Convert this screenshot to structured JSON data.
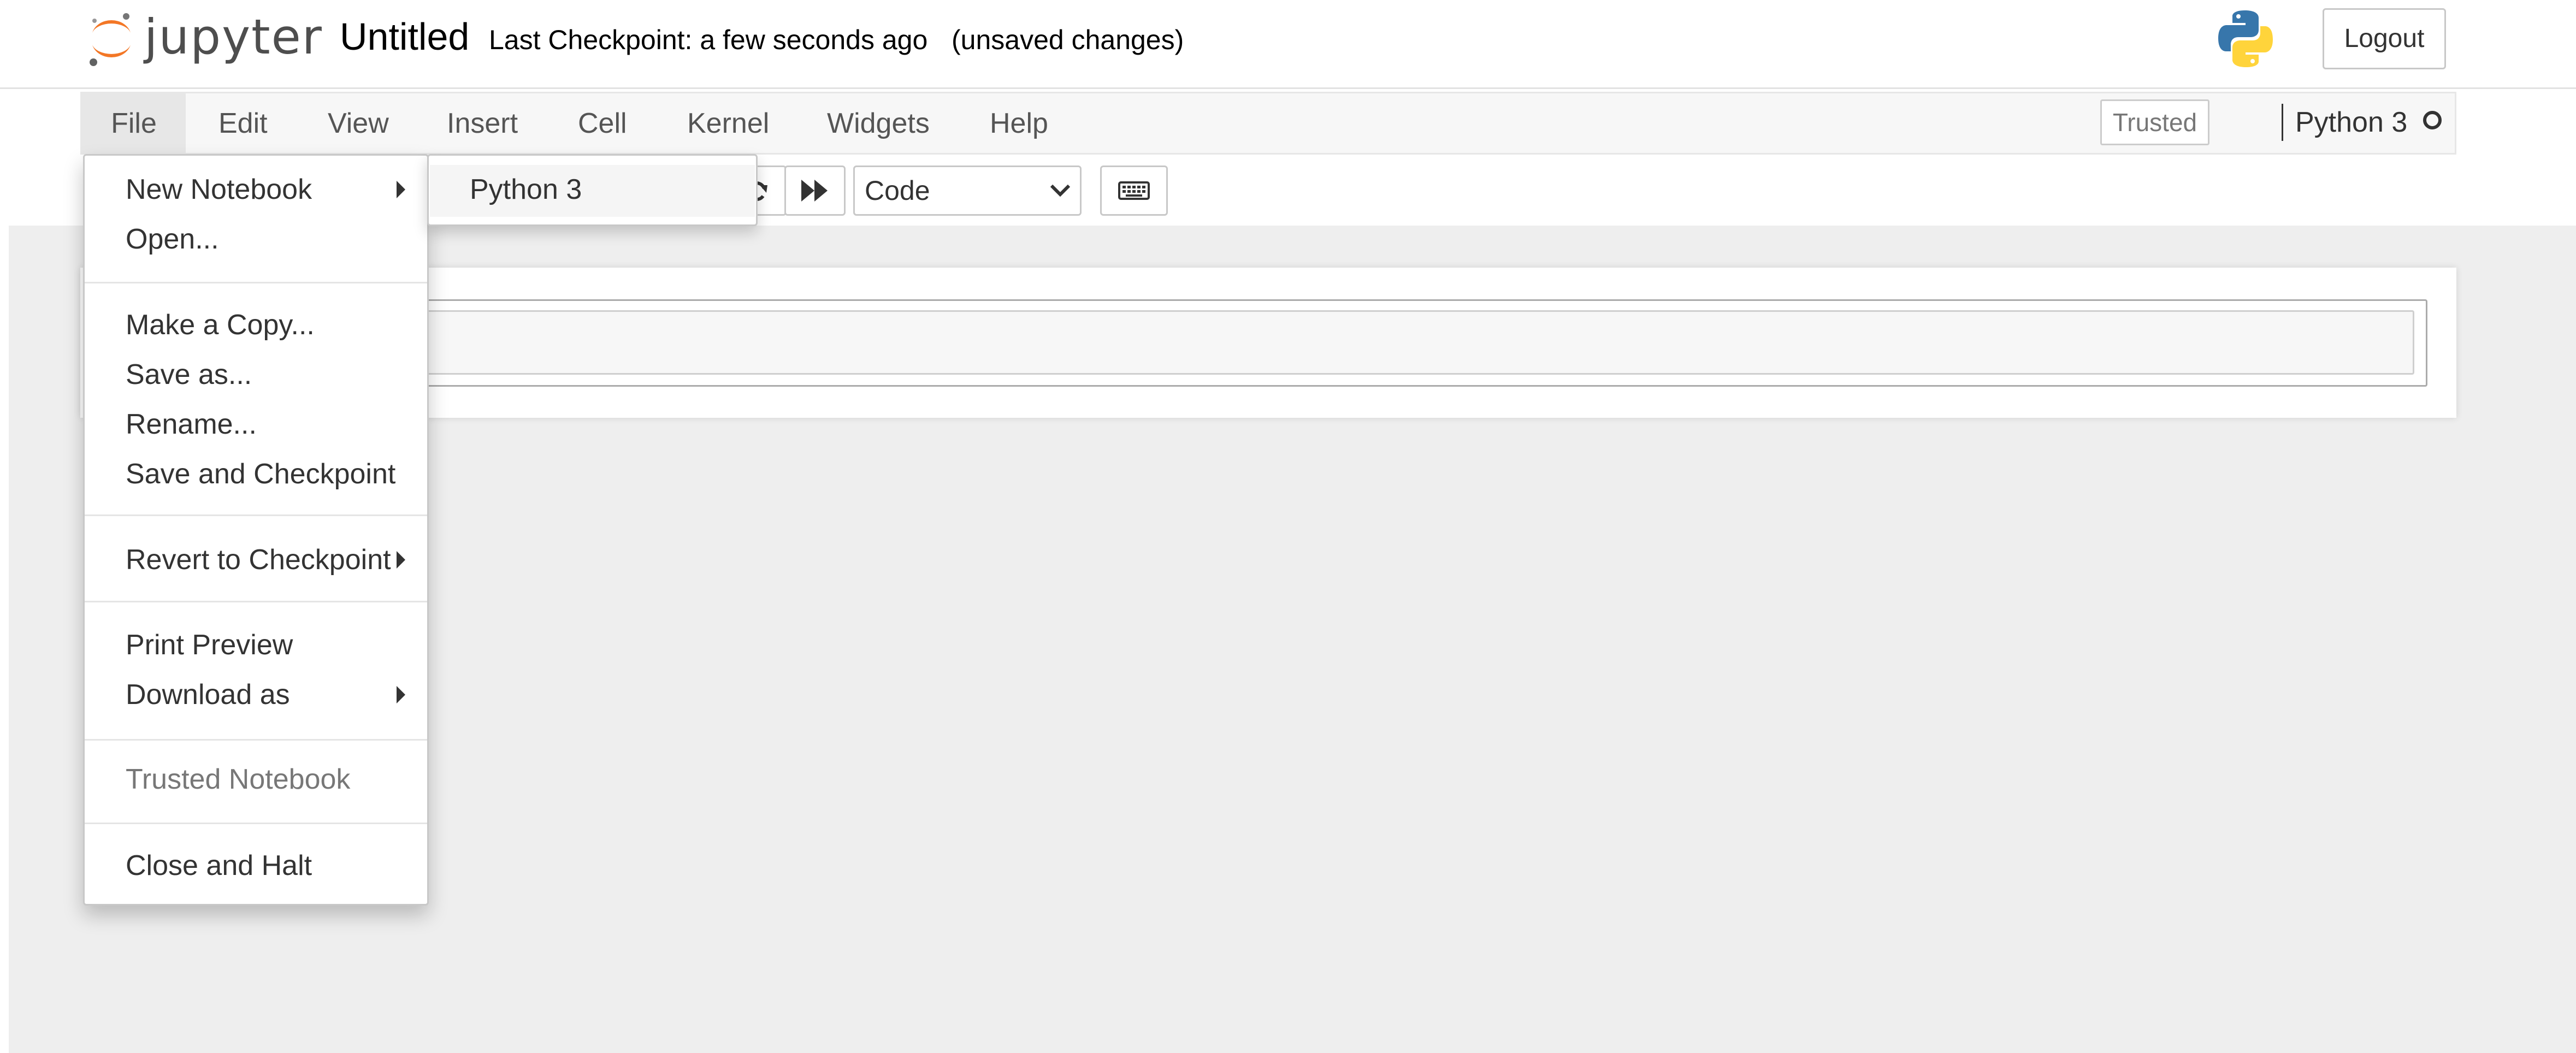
{
  "header": {
    "logo_text": "jupyter",
    "notebook_title": "Untitled",
    "checkpoint_text": "Last Checkpoint: a few seconds ago",
    "unsaved_text": "(unsaved changes)",
    "logout_label": "Logout"
  },
  "menubar": {
    "items": [
      {
        "label": "File"
      },
      {
        "label": "Edit"
      },
      {
        "label": "View"
      },
      {
        "label": "Insert"
      },
      {
        "label": "Cell"
      },
      {
        "label": "Kernel"
      },
      {
        "label": "Widgets"
      },
      {
        "label": "Help"
      }
    ],
    "trusted_label": "Trusted",
    "kernel_name": "Python 3"
  },
  "toolbar": {
    "cell_type_value": "Code"
  },
  "file_menu": {
    "new_notebook": "New Notebook",
    "open": "Open...",
    "make_copy": "Make a Copy...",
    "save_as": "Save as...",
    "rename": "Rename...",
    "save_checkpoint": "Save and Checkpoint",
    "revert_checkpoint": "Revert to Checkpoint",
    "print_preview": "Print Preview",
    "download_as": "Download as",
    "trusted_notebook": "Trusted Notebook",
    "close_halt": "Close and Halt"
  },
  "new_notebook_submenu": {
    "items": [
      {
        "label": "Python 3"
      }
    ]
  },
  "colors": {
    "jupyter_orange": "#f37726",
    "python_blue": "#3776ab",
    "python_yellow": "#ffd43b",
    "notebook_bg": "#eeeeee"
  }
}
